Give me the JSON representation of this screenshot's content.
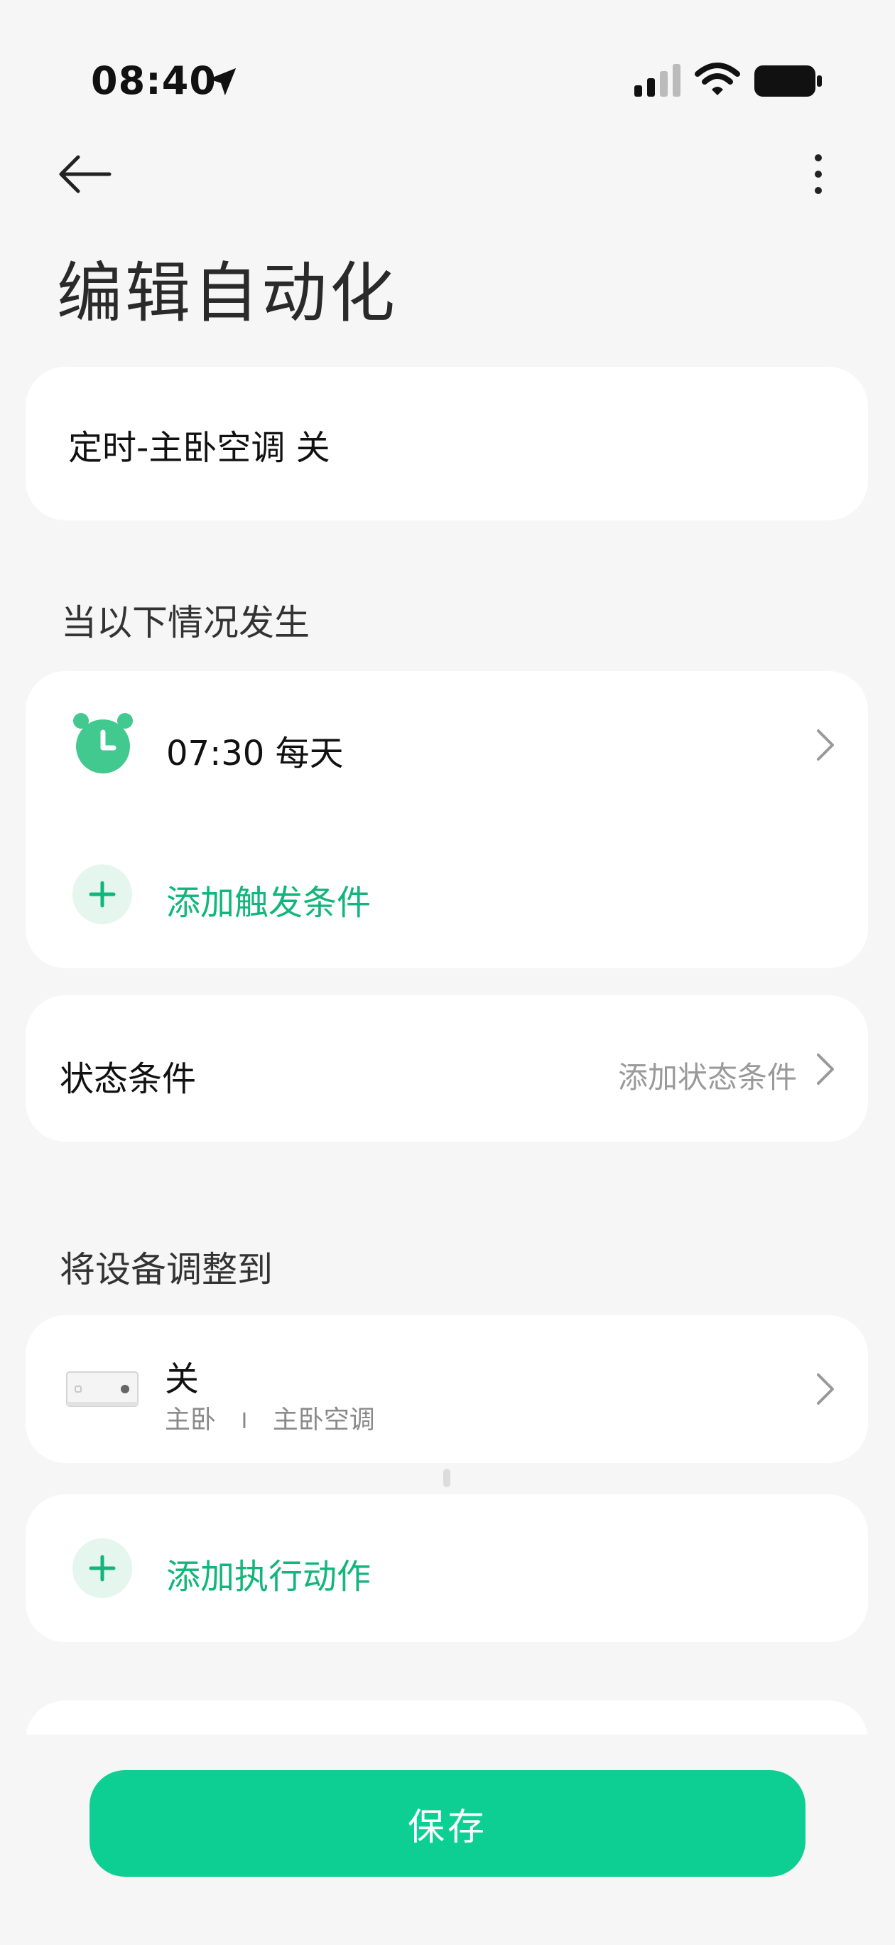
{
  "status_bar": {
    "time": "08:40"
  },
  "header": {
    "title": "编辑自动化"
  },
  "automation": {
    "name": "定时-主卧空调 关"
  },
  "trigger_section": {
    "label": "当以下情况发生",
    "trigger_text": "07:30 每天",
    "add_trigger_label": "添加触发条件"
  },
  "condition_section": {
    "label": "状态条件",
    "add_label": "添加状态条件"
  },
  "action_section": {
    "label": "将设备调整到",
    "action_title": "关",
    "action_room": "主卧",
    "action_divider": "I",
    "action_device": "主卧空调",
    "add_action_label": "添加执行动作"
  },
  "footer": {
    "save_label": "保存"
  },
  "colors": {
    "accent": "#0ecf93",
    "accent_text": "#12b67c",
    "background": "#f6f6f6"
  },
  "icons": [
    "location-arrow-icon",
    "cellular-signal-icon",
    "wifi-icon",
    "battery-icon",
    "back-arrow-icon",
    "more-vertical-icon",
    "alarm-clock-icon",
    "chevron-right-icon",
    "plus-icon",
    "air-conditioner-icon"
  ]
}
